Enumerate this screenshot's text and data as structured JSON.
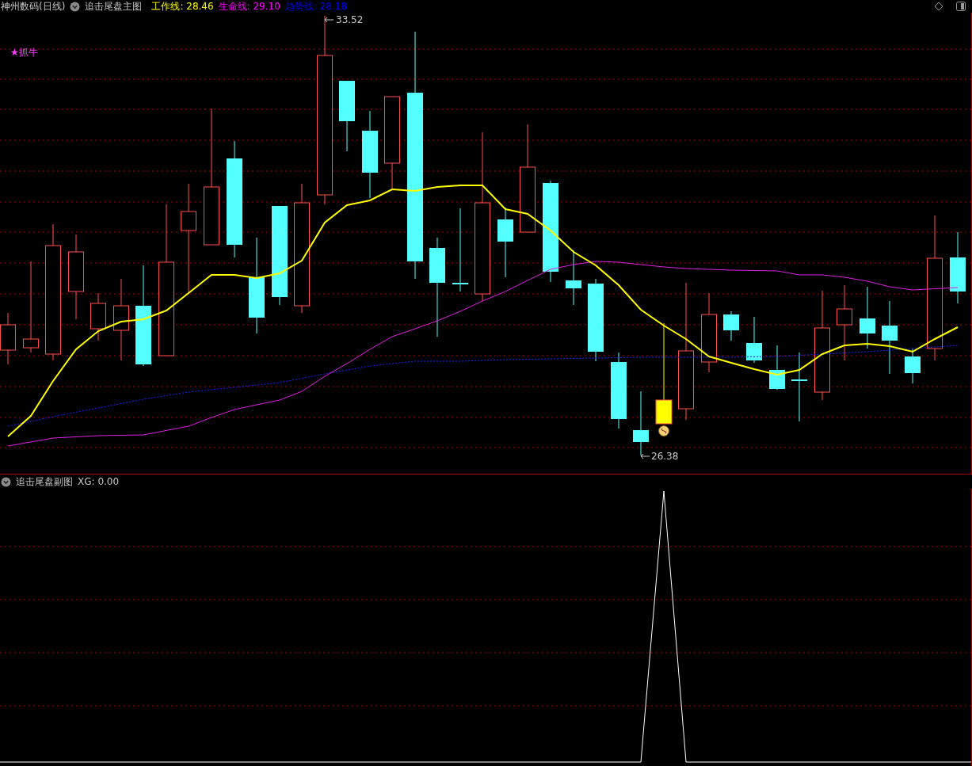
{
  "header": {
    "stock": "神州数码(日线)",
    "indicator": "追击尾盘主图",
    "legends": [
      {
        "label": "工作线:",
        "value": "28.46",
        "color": "#ffff00"
      },
      {
        "label": "生命线:",
        "value": "29.10",
        "color": "#ff00ff"
      },
      {
        "label": "趋势线:",
        "value": "28.18",
        "color": "#0000ff"
      }
    ]
  },
  "main_chart": {
    "signal": "★抓牛",
    "high_label": "33.52",
    "low_label": "26.38"
  },
  "sub_chart": {
    "indicator": "追击尾盘副图",
    "reading": "XG: 0.00"
  }
}
